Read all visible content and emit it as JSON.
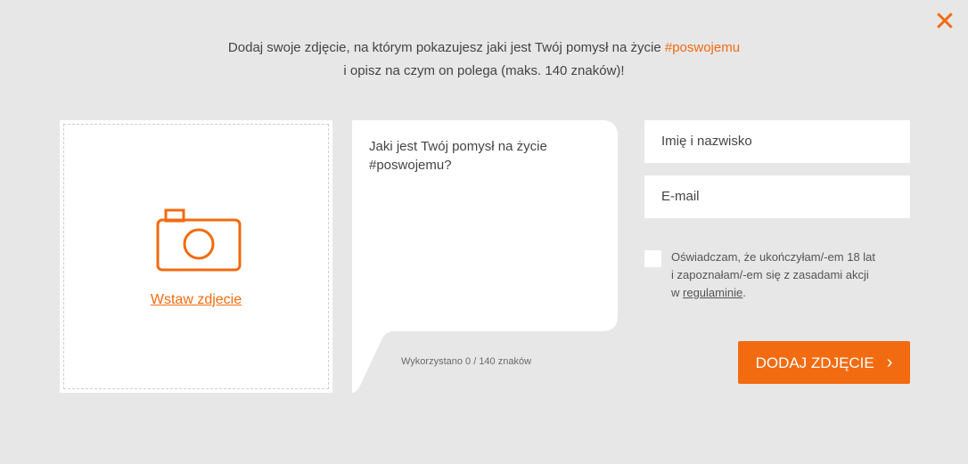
{
  "close": {
    "icon": "close-icon"
  },
  "intro": {
    "line1": "Dodaj swoje zdjęcie, na którym pokazujesz jaki jest Twój pomysł na życie",
    "hashtag": "#poswojemu",
    "line2": "i opisz na czym on polega (maks. 140 znaków)!"
  },
  "photo": {
    "icon": "camera-icon",
    "insert_label": "Wstaw zdjecie"
  },
  "idea": {
    "placeholder_line1": "Jaki jest Twój pomysł na życie",
    "placeholder_line2": "#poswojemu?",
    "counter": "Wykorzystano 0 / 140 znaków"
  },
  "form": {
    "name_placeholder": "Imię i nazwisko",
    "email_placeholder": "E-mail",
    "consent_line1": "Oświadczam, że ukończyłam/-em 18 lat",
    "consent_line2": "i zapoznałam/-em się z zasadami akcji",
    "consent_prefix": "w",
    "consent_link": "regulaminie",
    "consent_suffix": ".",
    "submit_label": "DODAJ ZDJĘCIE",
    "submit_icon": "chevron-right-icon"
  },
  "colors": {
    "accent": "#f26b10",
    "background": "#e7e7e7",
    "panel": "#ffffff"
  }
}
